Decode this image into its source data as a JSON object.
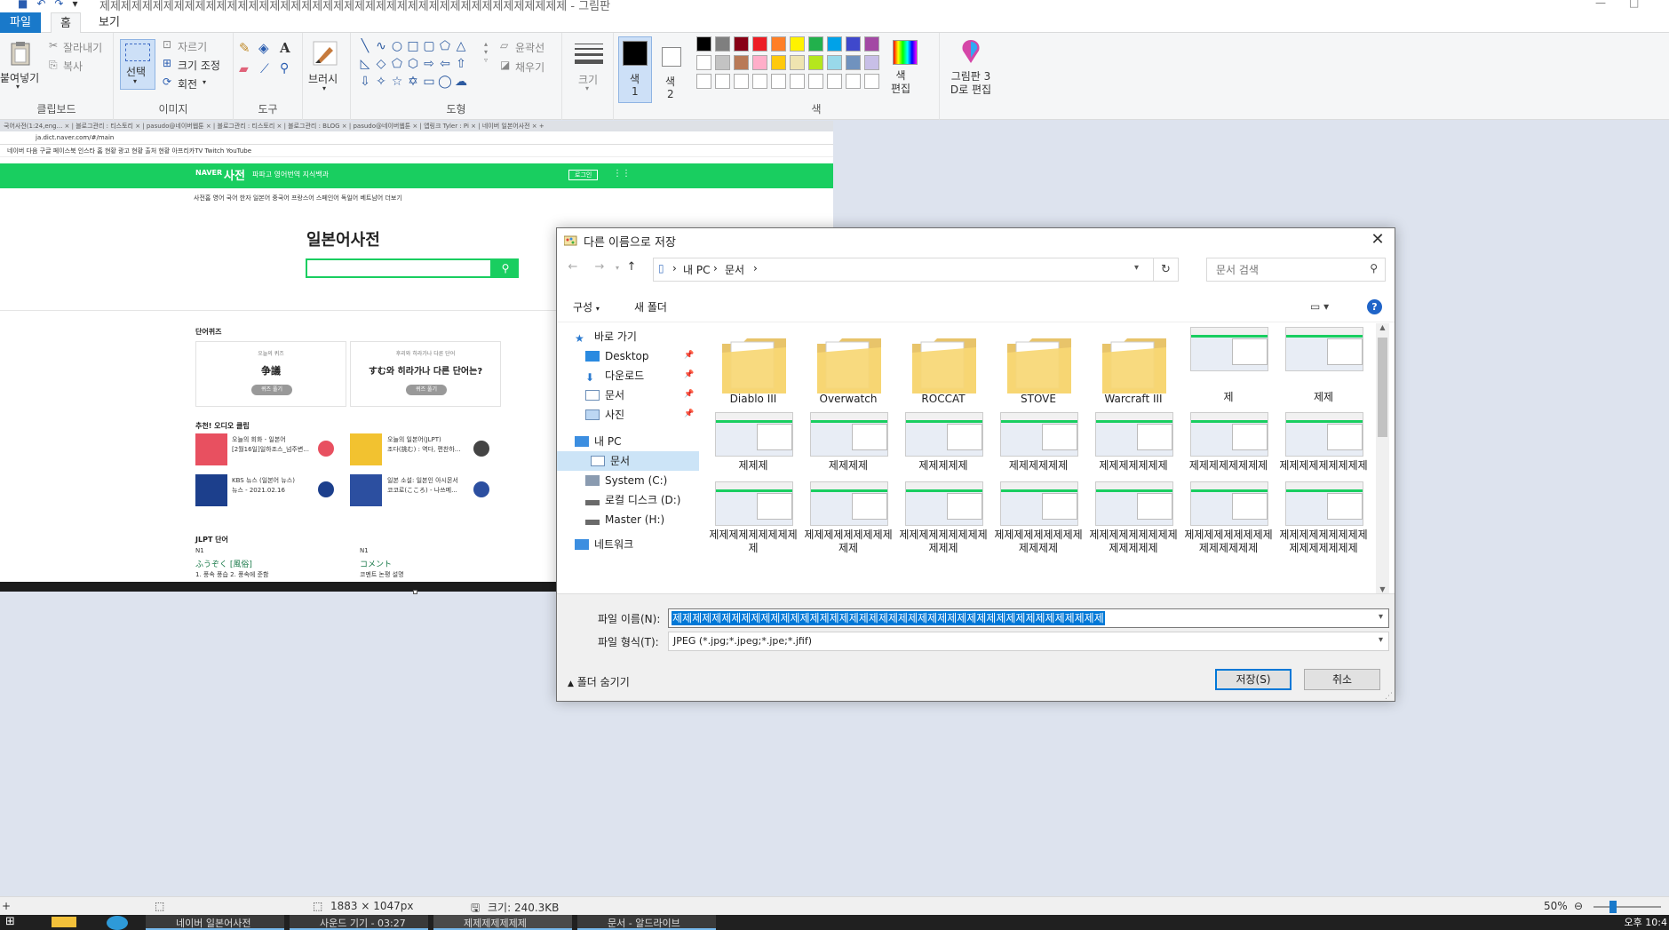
{
  "app": {
    "title": "제제제제제제제제제제제제제제제제제제제제제제제제제제제제제제제제제제제제제제제제제제제제 - 그림판",
    "tabs": {
      "file": "파일",
      "home": "홈",
      "view": "보기"
    }
  },
  "ribbon": {
    "clipboard": {
      "paste": "붙여넣기",
      "cut": "잘라내기",
      "copy": "복사",
      "label": "클립보드"
    },
    "image": {
      "select": "선택",
      "crop": "자르기",
      "resize": "크기 조정",
      "rotate": "회전",
      "label": "이미지"
    },
    "tools": {
      "label": "도구",
      "text_tool": "A"
    },
    "brushes": {
      "label": "브러시"
    },
    "shapes": {
      "outline": "윤곽선",
      "fill": "채우기",
      "label": "도형"
    },
    "size": {
      "label": "크기"
    },
    "color1": {
      "label": "색",
      "num": "1",
      "value": "#000000"
    },
    "color2": {
      "label": "색",
      "num": "2",
      "value": "#ffffff"
    },
    "colors": {
      "label": "색",
      "row1": [
        "#000000",
        "#7f7f7f",
        "#880015",
        "#ed1c24",
        "#ff7f27",
        "#fff200",
        "#22b14c",
        "#00a2e8",
        "#3f48cc",
        "#a349a4"
      ],
      "row2": [
        "#ffffff",
        "#c3c3c3",
        "#b97a57",
        "#ffaec9",
        "#ffc90e",
        "#efe4b0",
        "#b5e61d",
        "#99d9ea",
        "#7092be",
        "#c8bfe7"
      ],
      "row3": [
        "#ffffff",
        "#ffffff",
        "#ffffff",
        "#ffffff",
        "#ffffff",
        "#ffffff",
        "#ffffff",
        "#ffffff",
        "#ffffff",
        "#ffffff"
      ]
    },
    "edit_colors": "색\n편집",
    "paint3d": "그림판 3\nD로 편집"
  },
  "browser": {
    "url": "ja.dict.naver.com/#/main",
    "tabs_text": "국어사전(1:24,eng...  ×   | 블로그관리 : 티스토리 ×  | pasudo@네이버웹툰 ×  | 블로그관리 : 티스토리 ×  | 블로그관리 : BLOG ×  | pasudo@네이버웹툰 ×  | 앱링크 Tyler : Pi ×  | 네이버 일본어사전 ×  +",
    "bookmarks": "네이버   다음   구글   페이스북   인스타   홈 현황   광고 현황   출처 현황   아프리카TV   Twitch   YouTube",
    "logo": "NAVER",
    "dict": "사전",
    "nav": "파파고    영어번역    지식백과",
    "login": "로그인",
    "subnav": "사전홈   영어   국어   한자   일본어   중국어   프랑스어   스페인어   독일어   베트남어   더보기",
    "jp_title": "일본어사전",
    "quiz_section": "단어퀴즈",
    "quiz1": {
      "kicker": "오늘의 퀴즈",
      "word": "争議",
      "btn": "퀴즈 풀기"
    },
    "quiz2": {
      "kicker": "후리와 히라가나 다른 단어",
      "word": "すむ와 히라가나 다른 단어는?",
      "btn": "퀴즈 풀기"
    },
    "audio_section": "추천! 오디오 클립",
    "clip1": "오늘의 회화 - 일본어\n[2월16일]일하조스_넘주변...",
    "clip2": "오늘의 일본어(JLPT)\n조다(挑む) : 역다, 편찬하...",
    "clip3": "KBS 뉴스 (일본어 뉴스)\n뉴스 - 2021.02.16",
    "clip4": "일본 소설: 일본인 아시몬서\n코코로(こころ) - 나쓰메...",
    "jlpt_section": "JLPT 단어",
    "jlpt1_level": "N1",
    "jlpt1_word": "ふうぞく [風俗]",
    "jlpt1_def": "1. 풍속 풍습 2. 풍속에 준함",
    "jlpt2_level": "N1",
    "jlpt2_word": "コメント",
    "jlpt2_def": "코멘트 논평 설명"
  },
  "dialog": {
    "title": "다른 이름으로 저장",
    "address": {
      "pc": "내 PC",
      "docs": "문서"
    },
    "search_placeholder": "문서 검색",
    "organize": "구성",
    "new_folder": "새 폴더",
    "nav": [
      {
        "name": "quick-access",
        "label": "바로 가기",
        "pinned": false
      },
      {
        "name": "desktop",
        "label": "Desktop",
        "pinned": true
      },
      {
        "name": "downloads",
        "label": "다운로드",
        "pinned": true
      },
      {
        "name": "documents-quick",
        "label": "문서",
        "pinned": true
      },
      {
        "name": "pictures",
        "label": "사진",
        "pinned": true
      },
      {
        "name": "this-pc",
        "label": "내 PC",
        "pinned": false
      },
      {
        "name": "documents",
        "label": "문서",
        "pinned": false
      },
      {
        "name": "system-c",
        "label": "System (C:)",
        "pinned": false
      },
      {
        "name": "local-d",
        "label": "로컬 디스크 (D:)",
        "pinned": false
      },
      {
        "name": "master-h",
        "label": "Master (H:)",
        "pinned": false
      },
      {
        "name": "network",
        "label": "네트워크",
        "pinned": false
      }
    ],
    "files": [
      {
        "name": "Diablo III",
        "kind": "folder"
      },
      {
        "name": "Overwatch",
        "kind": "folder"
      },
      {
        "name": "ROCCAT",
        "kind": "folder"
      },
      {
        "name": "STOVE",
        "kind": "folder"
      },
      {
        "name": "Warcraft III",
        "kind": "folder"
      },
      {
        "name": "제",
        "kind": "image"
      },
      {
        "name": "제제",
        "kind": "image"
      },
      {
        "name": "제제제",
        "kind": "image"
      },
      {
        "name": "제제제제",
        "kind": "image"
      },
      {
        "name": "제제제제제",
        "kind": "image"
      },
      {
        "name": "제제제제제제",
        "kind": "image"
      },
      {
        "name": "제제제제제제제",
        "kind": "image"
      },
      {
        "name": "제제제제제제제제",
        "kind": "image"
      },
      {
        "name": "제제제제제제제제제",
        "kind": "image"
      },
      {
        "name": "제제제제제제제제제제",
        "kind": "image"
      },
      {
        "name": "제제제제제제제제제제제",
        "kind": "image"
      },
      {
        "name": "제제제제제제제제제제제제",
        "kind": "image"
      },
      {
        "name": "제제제제제제제제제제제제제",
        "kind": "image"
      },
      {
        "name": "제제제제제제제제제제제제제제",
        "kind": "image"
      },
      {
        "name": "제제제제제제제제제제제제제제제",
        "kind": "image"
      },
      {
        "name": "제제제제제제제제제제제제제제제제",
        "kind": "image"
      }
    ],
    "filename_label": "파일 이름(N):",
    "filename_value": "제제제제제제제제제제제제제제제제제제제제제제제제제제제제제제제제제제제제제제제제제제제제",
    "filetype_label": "파일 형식(T):",
    "filetype_value": "JPEG (*.jpg;*.jpeg;*.jpe;*.jfif)",
    "hide_folders": "폴더 숨기기",
    "save": "저장(S)",
    "cancel": "취소"
  },
  "status": {
    "dimensions": "1883 × 1047px",
    "size": "크기: 240.3KB",
    "zoom": "50%"
  },
  "taskbar": {
    "items": [
      "네이버 일본어사전",
      "사운드 기기 - 03:27",
      "제제제제제제제",
      "문서 - 알드라이브"
    ],
    "clock": "오후 10:4"
  }
}
